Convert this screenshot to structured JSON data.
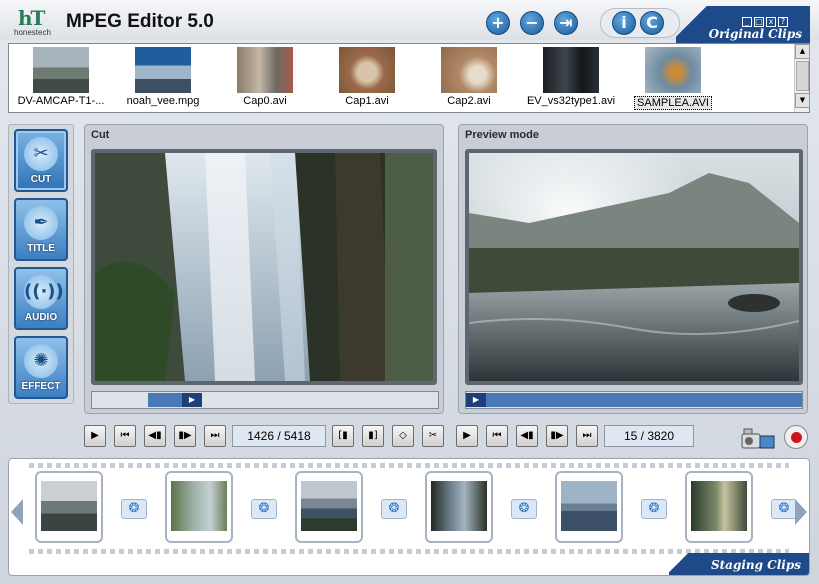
{
  "app": {
    "title": "MPEG Editor 5.0",
    "logo_mark": "hT",
    "brand": "honestech"
  },
  "header": {
    "action_icons": [
      "add-icon",
      "remove-icon",
      "split-icon"
    ],
    "info_icon": "i",
    "c_icon": "C",
    "window_controls": [
      "_",
      "□",
      "x",
      "?"
    ],
    "original_clips_label": "Original Clips"
  },
  "clips": [
    {
      "label": "DV-AMCAP-T1-...",
      "selected": false
    },
    {
      "label": "noah_vee.mpg",
      "selected": false
    },
    {
      "label": "Cap0.avi",
      "selected": false
    },
    {
      "label": "Cap1.avi",
      "selected": false
    },
    {
      "label": "Cap2.avi",
      "selected": false
    },
    {
      "label": "EV_vs32type1.avi",
      "selected": false
    },
    {
      "label": "SAMPLEA.AVI",
      "selected": true
    }
  ],
  "tools": [
    {
      "label": "CUT",
      "icon": "scissors-icon",
      "active": true
    },
    {
      "label": "TITLE",
      "icon": "pen-nib-icon",
      "active": false
    },
    {
      "label": "AUDIO",
      "icon": "sound-waves-icon",
      "active": false
    },
    {
      "label": "EFFECT",
      "icon": "swirl-icon",
      "active": false
    }
  ],
  "cut_panel": {
    "title": "Cut",
    "counter": "1426 / 5418",
    "progress": 0.26
  },
  "preview_panel": {
    "title": "Preview  mode",
    "counter": "15 / 3820",
    "progress": 1.0
  },
  "staging": {
    "label": "Staging Clips",
    "clip_count": 6
  },
  "colors": {
    "accent": "#1f4a8a",
    "button_blue": "#3b7fc2",
    "record_red": "#d0141e"
  }
}
